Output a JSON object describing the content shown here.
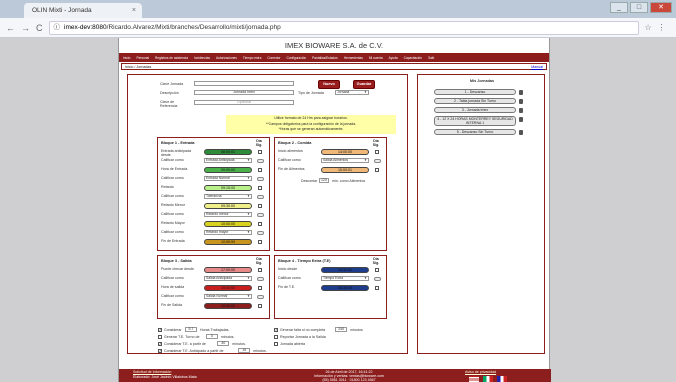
{
  "browser": {
    "tab_title": "OLIN Mixti - Jornada",
    "tab_close": "×",
    "back": "←",
    "forward": "→",
    "reload": "C",
    "info": "ⓘ",
    "url_host": "imex-dev:8080",
    "url_path": "/Ricardo.Alvarez/Mixti/branches/Desarrollo/mixti/jornada.php",
    "min": "_",
    "max": "□",
    "close": "✕",
    "star": "☆",
    "menu": "⋮"
  },
  "site": {
    "title": "IMEX BIOWARE S.A. de C.V.",
    "menu": [
      "Inicio",
      "Personal",
      "Registros de asistencia",
      "Incidencias",
      "Autorizaciones",
      "Tiempo extra",
      "Comedor",
      "Configuración",
      "Pantallas/Estados",
      "Herramientas",
      "Mi cuenta",
      "Ayuda",
      "Capacitación",
      "Salir"
    ]
  },
  "crumb": {
    "left": "Inicio / Jornadas",
    "right": "Manual"
  },
  "form": {
    "clave_label": "Clave Jornada",
    "clave_value": "",
    "desc_label": "Descripción",
    "desc_value": "Jornada Imex",
    "tipo_label": "Tipo de Jornada",
    "tipo_value": "Jornada",
    "claveref_label": "Clave de Referencia",
    "claveref_value": "Opcional",
    "nuevo": "Nuevo",
    "guardar": "Guardar"
  },
  "notice": [
    "Utilice formato de 24 Hrs para asignar horarios.",
    "**Campos obligatorios para la configuración de la jornada.",
    "*Horas que se generan automáticamente."
  ],
  "bloque1": {
    "title": "Bloque 1 - Entrada",
    "dia_sig": "Día Sig.",
    "rows": [
      {
        "label": "Entrada anticipada desde",
        "value": "08:00:01",
        "color": "#2e8b3a"
      },
      {
        "label": "Calificar como",
        "value": "Entrada Anticipada",
        "select": true
      },
      {
        "label": "Hora de Entrada",
        "value": "09:00:00",
        "color": "#4ab04a"
      },
      {
        "label": "Calificar como",
        "value": "Entrada Normal",
        "select": true
      },
      {
        "label": "Retardo",
        "value": "09:15:00",
        "color": "#b8f08a"
      },
      {
        "label": "Calificar como",
        "value": "Tolerancia",
        "select": true
      },
      {
        "label": "Retardo Menor",
        "value": "09:30:00",
        "color": "#f0f08a"
      },
      {
        "label": "Calificar como",
        "value": "Retardo menor",
        "select": true
      },
      {
        "label": "Retardo Mayor",
        "value": "10:00:00",
        "color": "#d8d21e"
      },
      {
        "label": "Calificar como",
        "value": "Retardo mayor",
        "select": true
      },
      {
        "label": "Fin de Entrada",
        "value": "10:59:59",
        "color": "#c8961e"
      }
    ]
  },
  "bloque2": {
    "title": "Bloque 2 - Comida",
    "dia_sig": "Día Sig.",
    "rows": [
      {
        "label": "Inicio alimentos",
        "value": "14:00:00",
        "color": "#f0b878"
      },
      {
        "label": "Calificar como",
        "value": "Salida Alimentos",
        "select": true
      },
      {
        "label": "Fin de Alimentos",
        "value": "15:00:01",
        "color": "#f0b878"
      }
    ],
    "descontar_label": "Descontar",
    "descontar_value": "120",
    "descontar_unit": "min. como Alimentos"
  },
  "bloque3": {
    "title": "Bloque 3 - Salida",
    "dia_sig": "Día Sig.",
    "rows": [
      {
        "label": "Puede checar desde",
        "value": "17:00:00",
        "color": "#e88a8a"
      },
      {
        "label": "Calificar como",
        "value": "Salida Anticipada",
        "select": true
      },
      {
        "label": "Hora de salida",
        "value": "19:00:00",
        "color": "#c81e1e"
      },
      {
        "label": "Calificar como",
        "value": "Salida Normal",
        "select": true
      },
      {
        "label": "Fin de Salida",
        "value": "19:30:00",
        "color": "#8c1e1e"
      }
    ]
  },
  "bloque4": {
    "title": "Bloque 4 - Tiempo Extra (T.E)",
    "dia_sig": "Día Sig.",
    "rows": [
      {
        "label": "Inicio desde",
        "value": "19:31:00",
        "color": "#1e3c8c"
      },
      {
        "label": "Calificar como",
        "value": "Tiempo Extra",
        "select": true
      },
      {
        "label": "Fin de T.E.",
        "value": "05:30:00",
        "color": "#1e3c8c"
      }
    ]
  },
  "options_left": [
    {
      "checked": true,
      "pre": "Considerar",
      "val": "5.7",
      "post": "Horas Trabajadas."
    },
    {
      "checked": false,
      "pre": "Generar T.E. Turno de",
      "val": "0",
      "post": "minutos."
    },
    {
      "checked": true,
      "pre": "Considerar T.E. a partir de",
      "val": "30",
      "post": "minutos."
    },
    {
      "checked": true,
      "pre": "Considerar T.E. Anticipado a partir de",
      "val": "15",
      "post": "minutos."
    }
  ],
  "options_right": [
    {
      "checked": true,
      "pre": "Generar falta si no completa",
      "val": "240",
      "post": "minutos"
    },
    {
      "checked": false,
      "pre": "Reportar Jornada a la Salida",
      "val": "",
      "post": ""
    },
    {
      "checked": false,
      "pre": "Jornada abierta",
      "val": "",
      "post": ""
    }
  ],
  "sidebar": {
    "title": "Mis Jornadas",
    "items": [
      "1 - Descanso",
      "2 - Tabla jornada Sin Turno",
      "3 - Jornada Imex",
      "4 - 12 X 24 HORAS MONTERREY SEGURIDAD INTERNA 1",
      "5 - Descanso Sin Turno"
    ]
  },
  "footer": {
    "left1": "Solicitud de Información",
    "left2": "Elaborado: José Jacinto Villalobos Mata",
    "center1": "26 de Abril de 2017, 16:41:22",
    "center2": "Información y ventas: ventas@bioware.com",
    "center3": "(55) 5561 3011 · 01800 123 4567",
    "right": "Aviso de privacidad"
  },
  "colors": {
    "brand": "#8c1e1e"
  }
}
